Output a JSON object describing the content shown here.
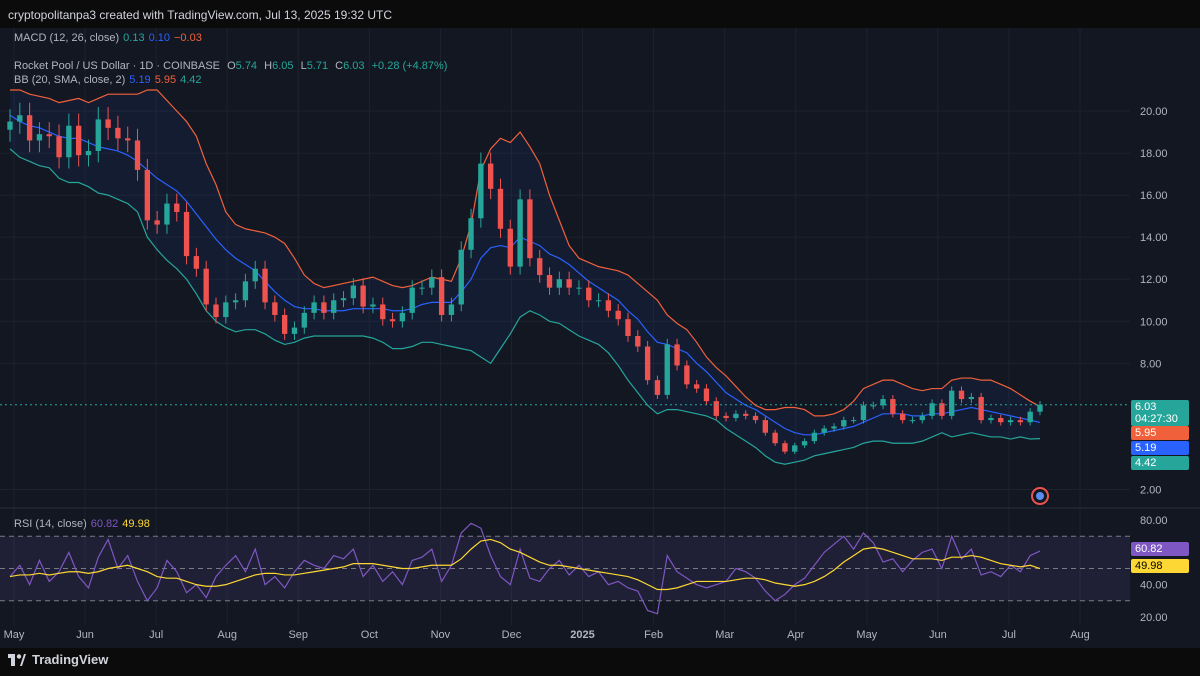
{
  "header": {
    "text": "cryptopolitanpa3 created with TradingView.com, Jul 13, 2025 19:32 UTC"
  },
  "macd": {
    "label": "MACD (12, 26, close)",
    "v1": "0.13",
    "v2": "0.10",
    "v3": "−0.03"
  },
  "symbol": {
    "name": "Rocket Pool / US Dollar · 1D · COINBASE",
    "o_label": "O",
    "o": "5.74",
    "h_label": "H",
    "h": "6.05",
    "l_label": "L",
    "l": "5.71",
    "c_label": "C",
    "c": "6.03",
    "chg": "+0.28 (+4.87%)"
  },
  "bb": {
    "label": "BB (20, SMA, close, 2)",
    "v1": "5.19",
    "v2": "5.95",
    "v3": "4.42"
  },
  "rsi": {
    "label": "RSI (14, close)",
    "v1": "60.82",
    "v2": "49.98"
  },
  "price_tags": {
    "last": "6.03",
    "countdown": "04:27:30",
    "upper": "5.95",
    "mid": "5.19",
    "lower": "4.42"
  },
  "rsi_tags": {
    "rsi": "60.82",
    "ma": "49.98"
  },
  "footer": {
    "brand": "TradingView"
  },
  "colors": {
    "up": "#26a69a",
    "down": "#ef5350",
    "basis": "#2962ff",
    "upper": "#f0613b",
    "lower": "#26a69a",
    "rsi": "#7e57c2",
    "rsi_ma": "#fdd835"
  },
  "chart_data": [
    {
      "type": "candlestick",
      "title": "Rocket Pool / US Dollar · 1D · COINBASE",
      "x_ticks": [
        "May",
        "Jun",
        "Jul",
        "Aug",
        "Sep",
        "Oct",
        "Nov",
        "Dec",
        "2025",
        "Feb",
        "Mar",
        "Apr",
        "May",
        "Jun",
        "Jul",
        "Aug"
      ],
      "y_ticks": [
        "20.00",
        "18.00",
        "16.00",
        "14.00",
        "12.00",
        "10.00",
        "8.00",
        "2.00"
      ],
      "ylim": [
        1.5,
        21
      ],
      "series": [
        {
          "name": "Close (approx.)",
          "values": [
            19.5,
            19.8,
            18.6,
            18.9,
            18.8,
            17.8,
            19.3,
            17.9,
            18.1,
            19.6,
            19.2,
            18.7,
            18.6,
            17.2,
            14.8,
            14.6,
            15.6,
            15.2,
            13.1,
            12.5,
            10.8,
            10.2,
            10.9,
            11.0,
            11.9,
            12.5,
            10.9,
            10.3,
            9.4,
            9.7,
            10.4,
            10.9,
            10.4,
            11.0,
            11.1,
            11.7,
            10.7,
            10.8,
            10.1,
            10.0,
            10.4,
            11.6,
            11.6,
            12.1,
            10.3,
            10.8,
            13.4,
            14.9,
            17.5,
            16.3,
            14.4,
            12.6,
            15.8,
            13.0,
            12.2,
            11.6,
            12.0,
            11.6,
            11.6,
            11.0,
            11.0,
            10.5,
            10.1,
            9.3,
            8.8,
            7.2,
            6.5,
            8.9,
            7.9,
            7.0,
            6.8,
            6.2,
            5.5,
            5.4,
            5.6,
            5.5,
            5.3,
            4.7,
            4.2,
            3.8,
            4.1,
            4.3,
            4.7,
            4.9,
            5.0,
            5.3,
            5.3,
            6.0,
            6.0,
            6.3,
            5.6,
            5.3,
            5.3,
            5.5,
            6.1,
            5.5,
            6.7,
            6.3,
            6.4,
            5.3,
            5.4,
            5.2,
            5.3,
            5.2,
            5.7,
            6.03
          ]
        },
        {
          "name": "BB basis (approx.)",
          "values": [
            19.8,
            19.5,
            19.3,
            19.2,
            19.0,
            18.8,
            18.7,
            18.7,
            18.5,
            18.3,
            18.2,
            18.1,
            17.9,
            17.6,
            17.2,
            16.8,
            16.5,
            16.2,
            15.7,
            15.1,
            14.5,
            13.9,
            13.4,
            13.0,
            12.7,
            12.4,
            11.9,
            11.4,
            11.0,
            10.7,
            10.6,
            10.6,
            10.5,
            10.5,
            10.5,
            10.6,
            10.6,
            10.6,
            10.6,
            10.5,
            10.5,
            10.6,
            10.8,
            10.9,
            10.9,
            10.9,
            11.4,
            12.0,
            13.0,
            13.5,
            13.6,
            13.5,
            14.0,
            13.8,
            13.6,
            13.2,
            13.0,
            12.7,
            12.3,
            11.9,
            11.6,
            11.3,
            11.0,
            10.5,
            10.1,
            9.5,
            9.0,
            8.9,
            8.7,
            8.5,
            8.0,
            7.6,
            7.1,
            6.6,
            6.3,
            6.0,
            5.8,
            5.5,
            5.2,
            4.9,
            4.7,
            4.6,
            4.6,
            4.7,
            4.8,
            4.9,
            5.0,
            5.2,
            5.4,
            5.6,
            5.6,
            5.6,
            5.5,
            5.5,
            5.6,
            5.6,
            5.7,
            5.8,
            5.9,
            5.8,
            5.7,
            5.6,
            5.5,
            5.4,
            5.3,
            5.19
          ]
        },
        {
          "name": "BB upper (approx.)",
          "values": [
            21.0,
            21.0,
            20.8,
            20.7,
            20.6,
            20.4,
            20.5,
            20.6,
            20.4,
            20.6,
            20.8,
            20.8,
            20.8,
            20.8,
            21.0,
            21.0,
            20.5,
            20.0,
            19.5,
            18.8,
            17.5,
            16.5,
            15.2,
            14.6,
            14.4,
            14.3,
            14.2,
            14.0,
            13.7,
            13.0,
            12.2,
            11.8,
            11.6,
            11.7,
            11.8,
            11.9,
            12.0,
            12.1,
            11.9,
            11.7,
            11.6,
            11.7,
            11.9,
            12.1,
            12.0,
            11.9,
            13.0,
            14.6,
            17.2,
            18.2,
            18.7,
            18.5,
            19.0,
            18.3,
            17.5,
            16.0,
            14.8,
            13.6,
            13.0,
            12.8,
            12.6,
            12.5,
            12.4,
            12.2,
            11.8,
            11.4,
            11.0,
            10.3,
            9.9,
            9.6,
            9.0,
            8.3,
            7.8,
            7.4,
            6.9,
            6.4,
            6.0,
            5.8,
            5.8,
            5.9,
            5.9,
            5.8,
            5.5,
            5.5,
            5.6,
            5.8,
            6.2,
            6.8,
            7.0,
            7.2,
            7.2,
            7.0,
            6.8,
            6.7,
            6.8,
            6.8,
            7.2,
            7.3,
            7.3,
            7.2,
            7.2,
            7.0,
            6.8,
            6.5,
            6.2,
            5.95
          ]
        },
        {
          "name": "BB lower (approx.)",
          "values": [
            18.2,
            17.8,
            17.6,
            17.4,
            17.3,
            16.8,
            16.6,
            16.6,
            16.4,
            16.1,
            16.0,
            15.8,
            15.6,
            15.2,
            14.0,
            13.4,
            12.9,
            12.5,
            12.0,
            11.3,
            10.5,
            10.0,
            9.7,
            9.5,
            9.6,
            9.6,
            9.4,
            9.1,
            8.9,
            9.0,
            9.2,
            9.3,
            9.3,
            9.3,
            9.3,
            9.3,
            9.3,
            9.2,
            9.0,
            8.7,
            8.7,
            8.8,
            9.0,
            9.0,
            8.9,
            8.8,
            8.7,
            8.6,
            8.3,
            8.0,
            8.7,
            9.4,
            10.2,
            10.5,
            10.3,
            10.0,
            9.9,
            9.6,
            9.3,
            9.1,
            8.9,
            8.5,
            7.9,
            7.2,
            6.6,
            6.0,
            5.6,
            5.8,
            5.8,
            5.7,
            5.6,
            5.5,
            5.3,
            4.9,
            4.6,
            4.3,
            4.0,
            3.6,
            3.3,
            3.2,
            3.3,
            3.4,
            3.6,
            3.7,
            3.8,
            3.9,
            4.0,
            4.2,
            4.3,
            4.3,
            4.2,
            4.2,
            4.2,
            4.3,
            4.5,
            4.7,
            4.5,
            4.6,
            4.7,
            4.6,
            4.5,
            4.5,
            4.4,
            4.5,
            4.4,
            4.42
          ]
        }
      ]
    },
    {
      "type": "line",
      "title": "RSI (14, close)",
      "y_ticks": [
        "80.00",
        "40.00",
        "20.00"
      ],
      "ylim": [
        15,
        85
      ],
      "series": [
        {
          "name": "RSI",
          "values": [
            45,
            52,
            40,
            55,
            42,
            48,
            60,
            45,
            38,
            57,
            68,
            50,
            58,
            42,
            30,
            38,
            55,
            48,
            35,
            40,
            32,
            45,
            52,
            58,
            48,
            62,
            40,
            45,
            38,
            48,
            55,
            52,
            50,
            58,
            56,
            62,
            45,
            52,
            42,
            48,
            40,
            55,
            57,
            62,
            42,
            52,
            72,
            78,
            75,
            58,
            45,
            40,
            62,
            44,
            42,
            50,
            55,
            46,
            52,
            45,
            48,
            40,
            42,
            38,
            36,
            24,
            22,
            58,
            48,
            44,
            40,
            38,
            40,
            42,
            50,
            48,
            44,
            36,
            30,
            34,
            40,
            44,
            52,
            60,
            65,
            70,
            62,
            72,
            66,
            54,
            56,
            48,
            55,
            60,
            62,
            50,
            70,
            56,
            62,
            46,
            48,
            45,
            52,
            48,
            58,
            60.82
          ]
        },
        {
          "name": "RSI-based MA",
          "values": [
            45,
            46,
            46,
            47,
            46,
            47,
            48,
            48,
            47,
            48,
            50,
            51,
            52,
            50,
            48,
            45,
            44,
            44,
            42,
            40,
            39,
            39,
            40,
            42,
            44,
            46,
            47,
            47,
            46,
            46,
            47,
            48,
            49,
            50,
            51,
            53,
            53,
            53,
            52,
            51,
            50,
            50,
            51,
            52,
            52,
            52,
            56,
            62,
            67,
            68,
            66,
            62,
            60,
            57,
            54,
            52,
            52,
            51,
            50,
            49,
            48,
            47,
            46,
            45,
            43,
            40,
            37,
            37,
            38,
            40,
            42,
            42,
            42,
            42,
            43,
            44,
            44,
            43,
            41,
            40,
            39,
            40,
            42,
            45,
            49,
            54,
            58,
            62,
            63,
            62,
            60,
            58,
            56,
            56,
            56,
            55,
            57,
            57,
            58,
            57,
            55,
            53,
            52,
            51,
            52,
            49.98
          ]
        }
      ]
    }
  ]
}
